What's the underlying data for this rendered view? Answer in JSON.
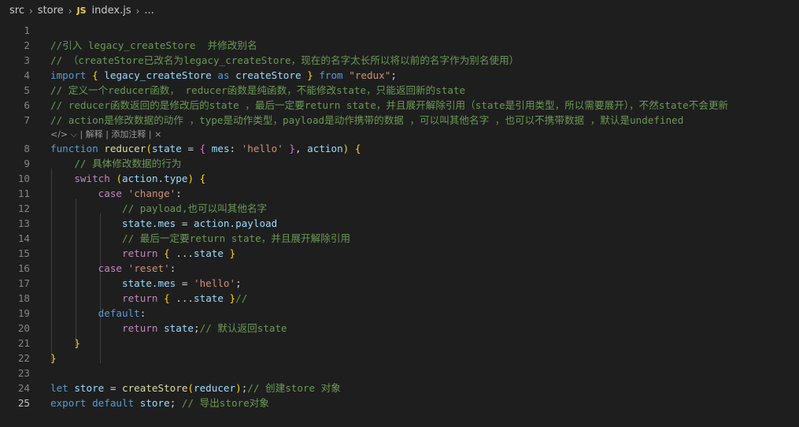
{
  "breadcrumb": {
    "items": [
      "src",
      "store",
      "index.js",
      "..."
    ],
    "file_icon": "JS"
  },
  "codelens": {
    "icon": "</>",
    "chevron": "⌵",
    "explain": "| 解释",
    "add_comment": "| 添加注释 |",
    "close": "×"
  },
  "lines": [
    {
      "n": "1",
      "text": ""
    },
    {
      "n": "2",
      "text": "//引入 legacy_createStore  并修改别名"
    },
    {
      "n": "3",
      "text": "// （createStore已改名为legacy_createStore，现在的名字太长所以将以前的名字作为别名使用）"
    },
    {
      "n": "4",
      "text": "import { legacy_createStore as createStore } from \"redux\";"
    },
    {
      "n": "5",
      "text": "// 定义一个reducer函数， reducer函数是纯函数，不能修改state，只能返回新的state"
    },
    {
      "n": "6",
      "text": "// reducer函数返回的是修改后的state ，最后一定要return state，并且展开解除引用（state是引用类型，所以需要展开），不然state不会更新"
    },
    {
      "n": "7",
      "text": "// action是修改数据的动作 ，type是动作类型，payload是动作携带的数据 ，可以叫其他名字 ，也可以不携带数据 ，默认是undefined"
    },
    {
      "n": "8",
      "text": "function reducer(state = { mes: 'hello' }, action) {"
    },
    {
      "n": "9",
      "text": "    // 具体修改数据的行为"
    },
    {
      "n": "10",
      "text": "    switch (action.type) {"
    },
    {
      "n": "11",
      "text": "        case 'change':"
    },
    {
      "n": "12",
      "text": "            // payload,也可以叫其他名字"
    },
    {
      "n": "13",
      "text": "            state.mes = action.payload"
    },
    {
      "n": "14",
      "text": "            // 最后一定要return state，并且展开解除引用"
    },
    {
      "n": "15",
      "text": "            return { ...state }"
    },
    {
      "n": "16",
      "text": "        case 'reset':"
    },
    {
      "n": "17",
      "text": "            state.mes = 'hello';"
    },
    {
      "n": "18",
      "text": "            return { ...state }//"
    },
    {
      "n": "19",
      "text": "        default:"
    },
    {
      "n": "20",
      "text": "            return state;// 默认返回state"
    },
    {
      "n": "21",
      "text": "    }"
    },
    {
      "n": "22",
      "text": "}"
    },
    {
      "n": "23",
      "text": ""
    },
    {
      "n": "24",
      "text": "let store = createStore(reducer);// 创建store 对象"
    },
    {
      "n": "25",
      "text": "export default store; // 导出store对象"
    }
  ],
  "active_line": "25",
  "colors": {
    "background": "#1e1e1e",
    "comment": "#6a9955",
    "keyword": "#569cd6",
    "control_keyword": "#c586c0",
    "string": "#ce9178",
    "function": "#dcdcaa",
    "variable": "#9cdcfe"
  }
}
